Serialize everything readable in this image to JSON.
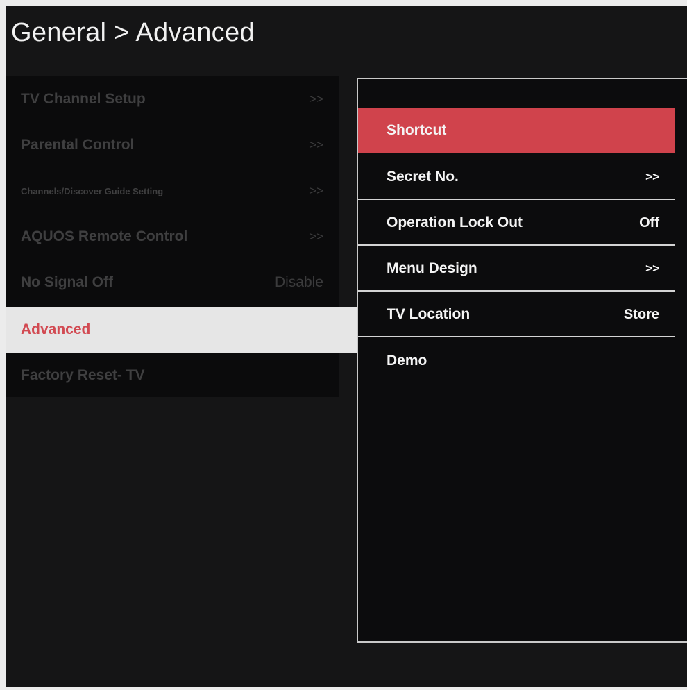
{
  "header": {
    "title": "General > Advanced"
  },
  "left_menu": [
    {
      "label": "TV Channel Setup",
      "value": ">>"
    },
    {
      "label": "Parental Control",
      "value": ">>"
    },
    {
      "label": "Channels/Discover Guide Setting",
      "value": ">>"
    },
    {
      "label": "AQUOS Remote Control",
      "value": ">>"
    },
    {
      "label": "No Signal Off",
      "value": "Disable"
    },
    {
      "label": "Advanced",
      "value": ""
    },
    {
      "label": "Factory Reset- TV",
      "value": ""
    }
  ],
  "submenu": [
    {
      "label": "Shortcut",
      "value": ""
    },
    {
      "label": "Secret No.",
      "value": ">>"
    },
    {
      "label": "Operation Lock Out",
      "value": "Off"
    },
    {
      "label": "Menu Design",
      "value": ">>"
    },
    {
      "label": "TV Location",
      "value": "Store"
    },
    {
      "label": "Demo",
      "value": ""
    }
  ],
  "colors": {
    "highlight": "#d0434c",
    "selected_text": "#d24a52",
    "background": "#151516"
  }
}
